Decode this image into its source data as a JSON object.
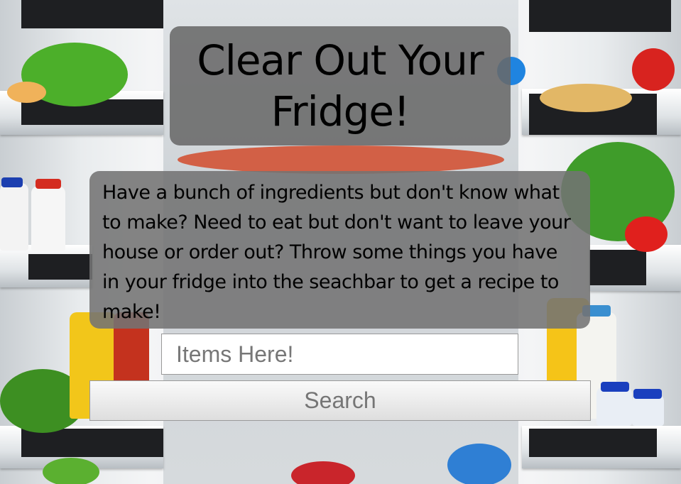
{
  "header": {
    "title": "Clear Out Your Fridge!"
  },
  "intro": {
    "text": "Have a bunch of ingredients but don't know what to make? Need to eat but don't want to leave your house or order out? Throw some things you have in your fridge into the seachbar to get a recipe to make!"
  },
  "search": {
    "placeholder": "Items Here!",
    "value": "",
    "button_label": "Search"
  },
  "colors": {
    "panel": "#6e6e6e",
    "text": "#000000",
    "button_text": "#757575"
  }
}
